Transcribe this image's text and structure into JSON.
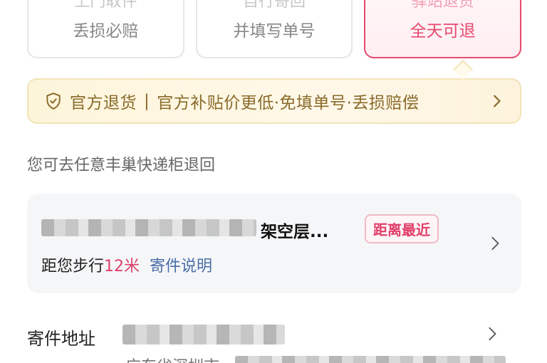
{
  "return_options": [
    {
      "line1": "上门取件",
      "line2": "丢损必赔",
      "selected": false
    },
    {
      "line1": "自行寄回",
      "line2": "并填写单号",
      "selected": false
    },
    {
      "line1": "驿站退货",
      "line2": "全天可退",
      "selected": true
    }
  ],
  "banner": {
    "title": "官方退货",
    "separator": "|",
    "text": "官方补贴价更低·免填单号·丢损赔偿"
  },
  "hint": "您可去任意丰巢快递柜退回",
  "locker": {
    "name": "架空层...",
    "badge": "距离最近",
    "distance_prefix": "距您步行",
    "distance_value": "12米",
    "info_link": "寄件说明"
  },
  "address": {
    "label": "寄件地址",
    "line2_partial": "广东省深圳市"
  },
  "colors": {
    "accent": "#e0406a",
    "banner_text": "#8a6a2a",
    "link": "#4a6fa8"
  }
}
